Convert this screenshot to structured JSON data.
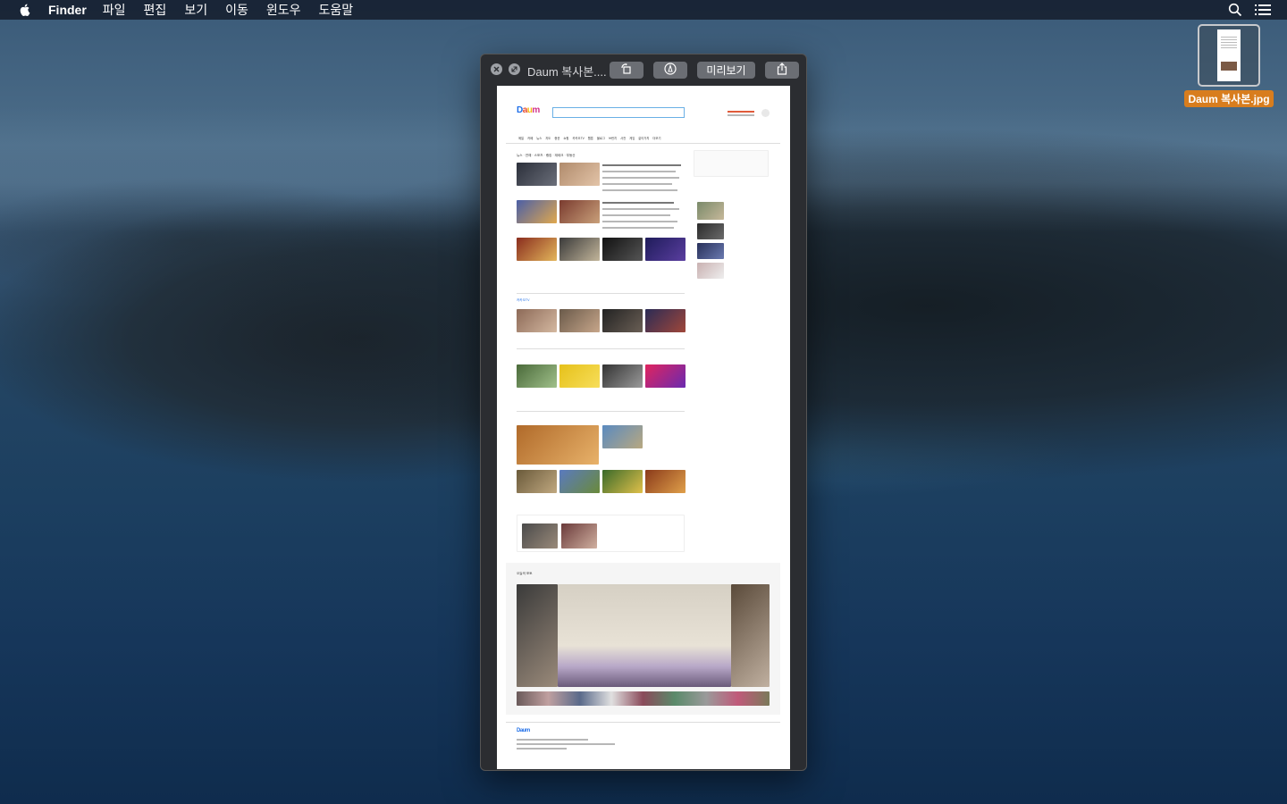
{
  "menubar": {
    "app_name": "Finder",
    "items": [
      "파일",
      "편집",
      "보기",
      "이동",
      "윈도우",
      "도움말"
    ],
    "icons": [
      "apple-icon",
      "spotlight-search-icon",
      "notification-center-icon"
    ]
  },
  "desktop": {
    "file_label": "Daum 복사본.jpg"
  },
  "quicklook": {
    "title": "Daum 복사본....",
    "open_button_label": "미리보기",
    "icons": [
      "close-icon",
      "fullscreen-icon",
      "rotate-icon",
      "markup-icon",
      "share-icon"
    ]
  },
  "daum_page": {
    "logo": {
      "d": "D",
      "a": "a",
      "u": "u",
      "m": "m"
    },
    "nav": [
      "메일",
      "카페",
      "뉴스",
      "지도",
      "증권",
      "쇼핑",
      "카카오TV",
      "웹툰",
      "블로그",
      "브런치",
      "사전",
      "게임",
      "같이가치",
      "더보기"
    ],
    "news_tabs": "뉴스 · 연예 · 스포츠 · 랭킹 · 재테크 · 부동산",
    "kakaotv_title": "카카오TV",
    "today_title": "오늘의 포토",
    "footer_logo": "Daum"
  },
  "colors": {
    "accent_orange": "#d87d1e",
    "window_bg": "#2b2d31",
    "daum_blue": "#1e6ee8",
    "daum_red": "#e84a2e",
    "daum_yellow": "#f5b90a",
    "daum_pink": "#d1338b"
  }
}
